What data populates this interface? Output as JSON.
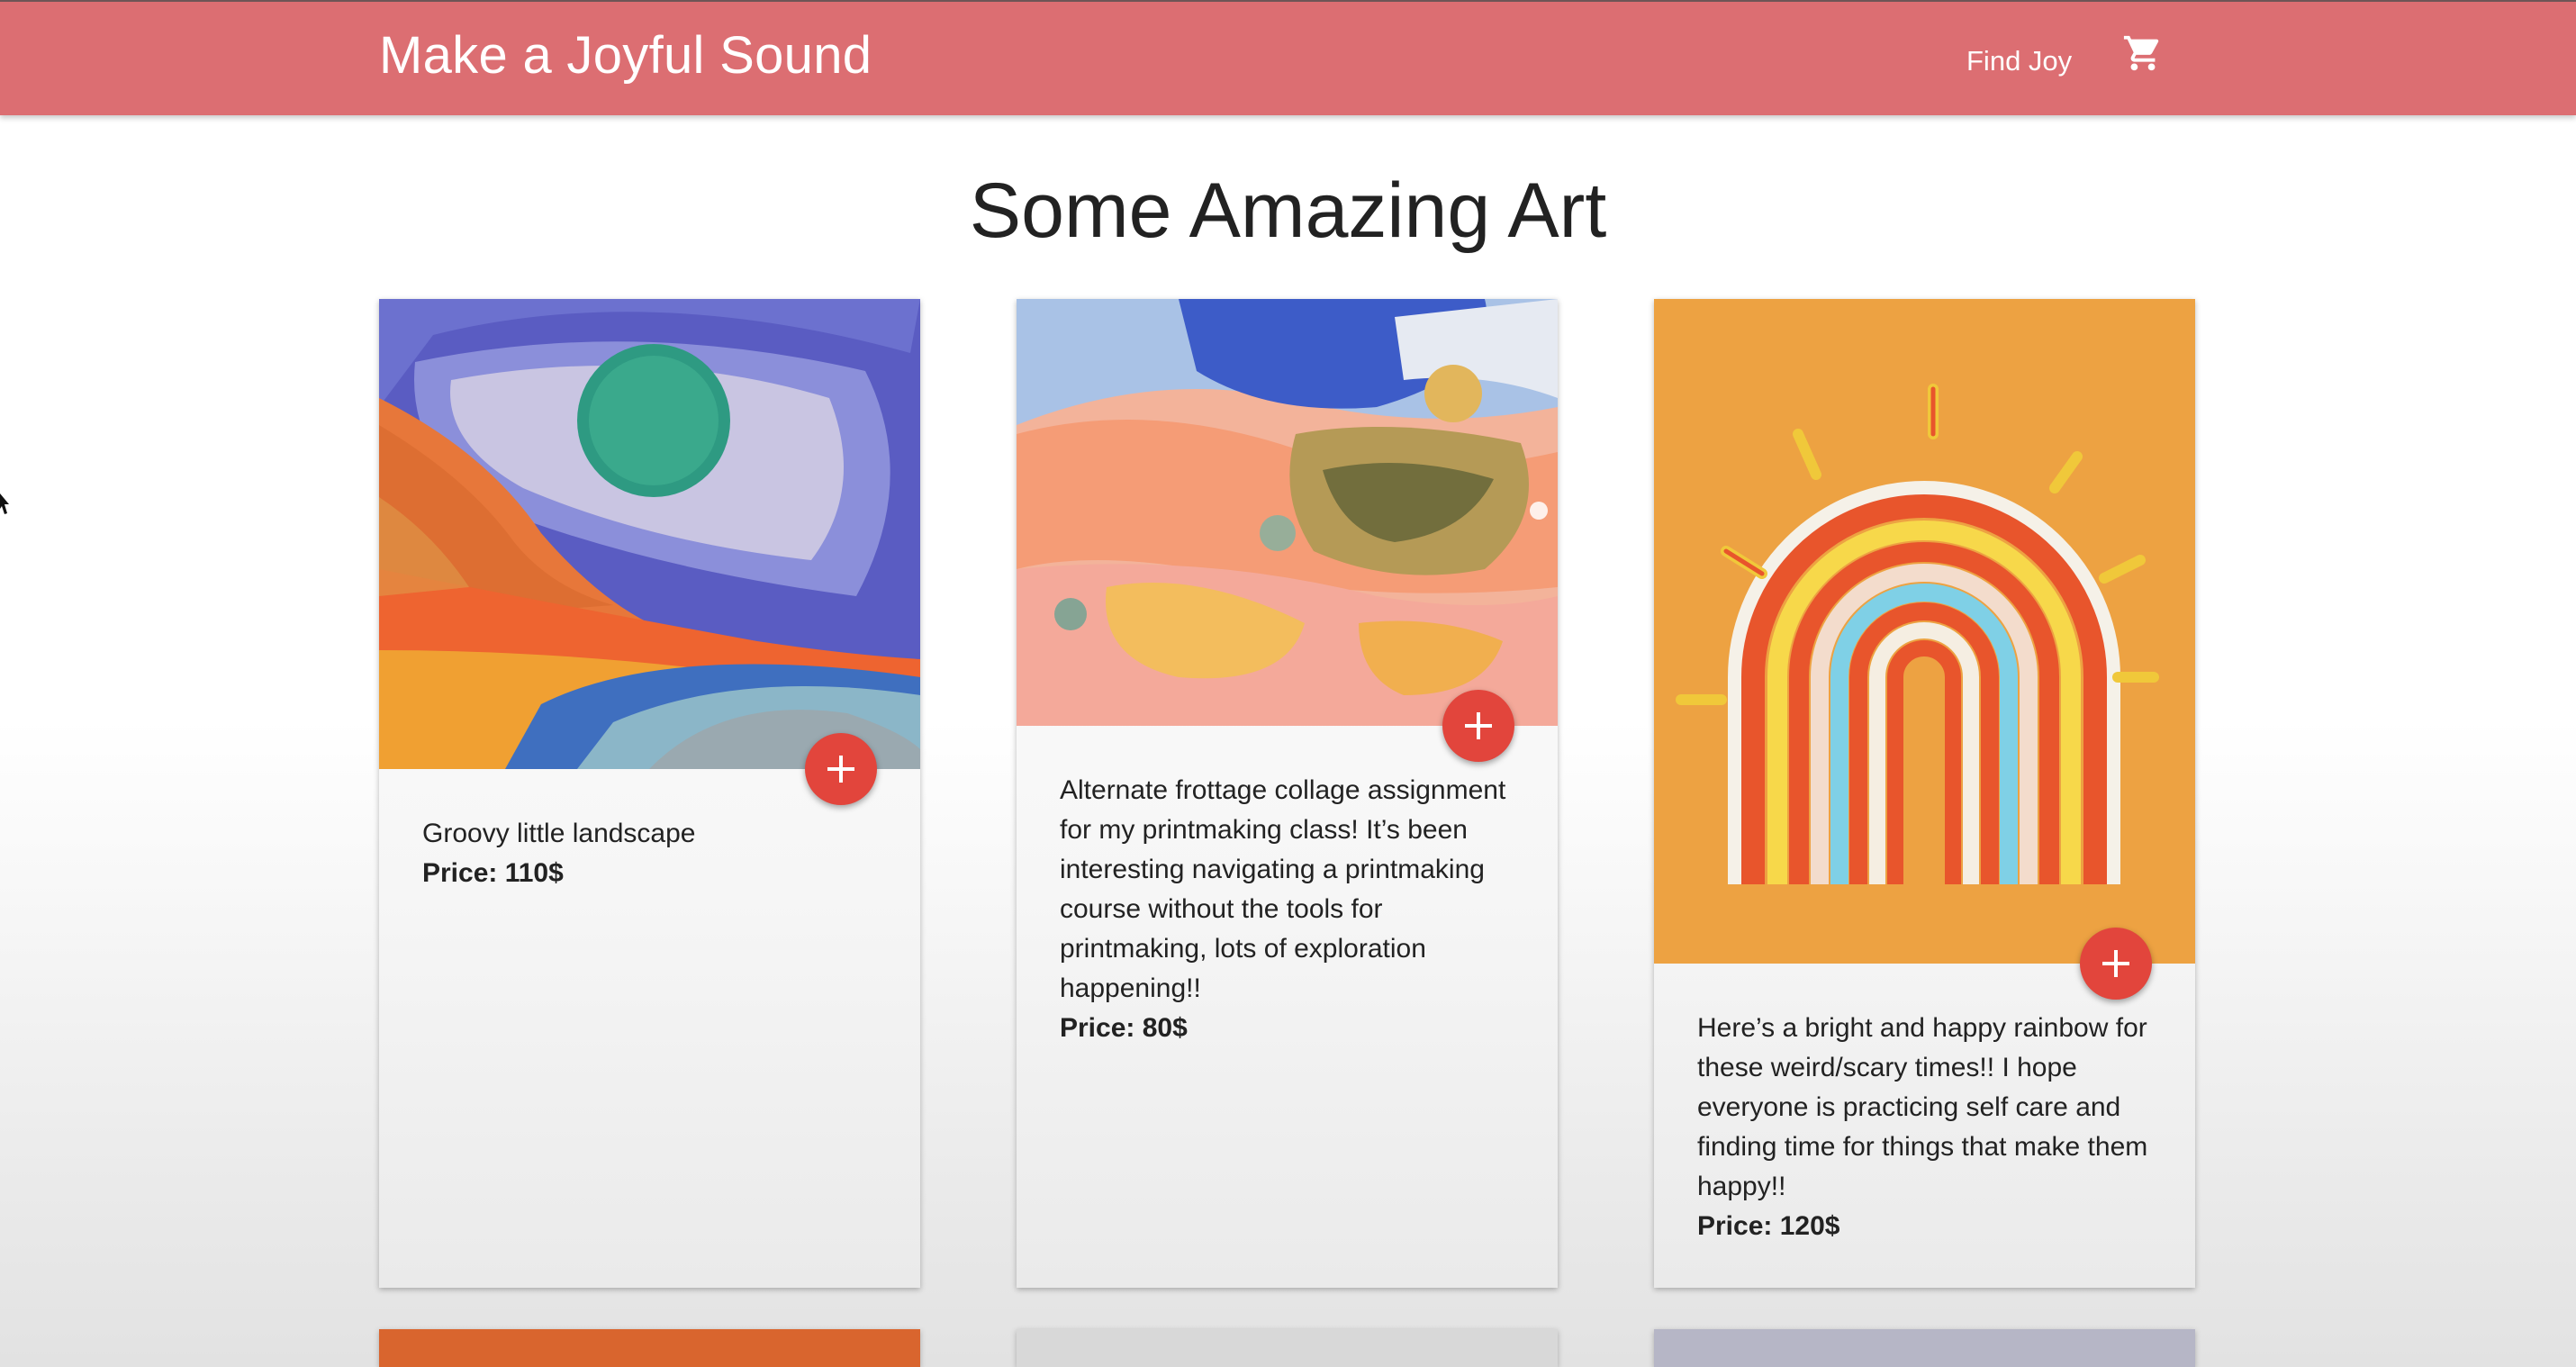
{
  "header": {
    "brand": "Make a Joyful Sound",
    "nav_link": "Find Joy",
    "cart_icon": "shopping-cart-icon"
  },
  "main": {
    "title": "Some Amazing Art",
    "cards": [
      {
        "description": "Groovy little landscape",
        "price": "Price: 110$",
        "add_icon": "plus-icon"
      },
      {
        "description": "Alternate frottage collage assignment for my printmaking class! It’s been interesting navigating a printmaking course without the tools for printmaking, lots of exploration happening!!",
        "price": "Price: 80$",
        "add_icon": "plus-icon"
      },
      {
        "description": "Here’s a bright and happy rainbow for these weird/scary times!! I hope everyone is practicing self care and finding time for things that make them happy!!",
        "price": "Price: 120$",
        "add_icon": "plus-icon"
      }
    ]
  },
  "colors": {
    "navbar": "#dc6e72",
    "fab": "#e2453c",
    "text": "#222222"
  }
}
